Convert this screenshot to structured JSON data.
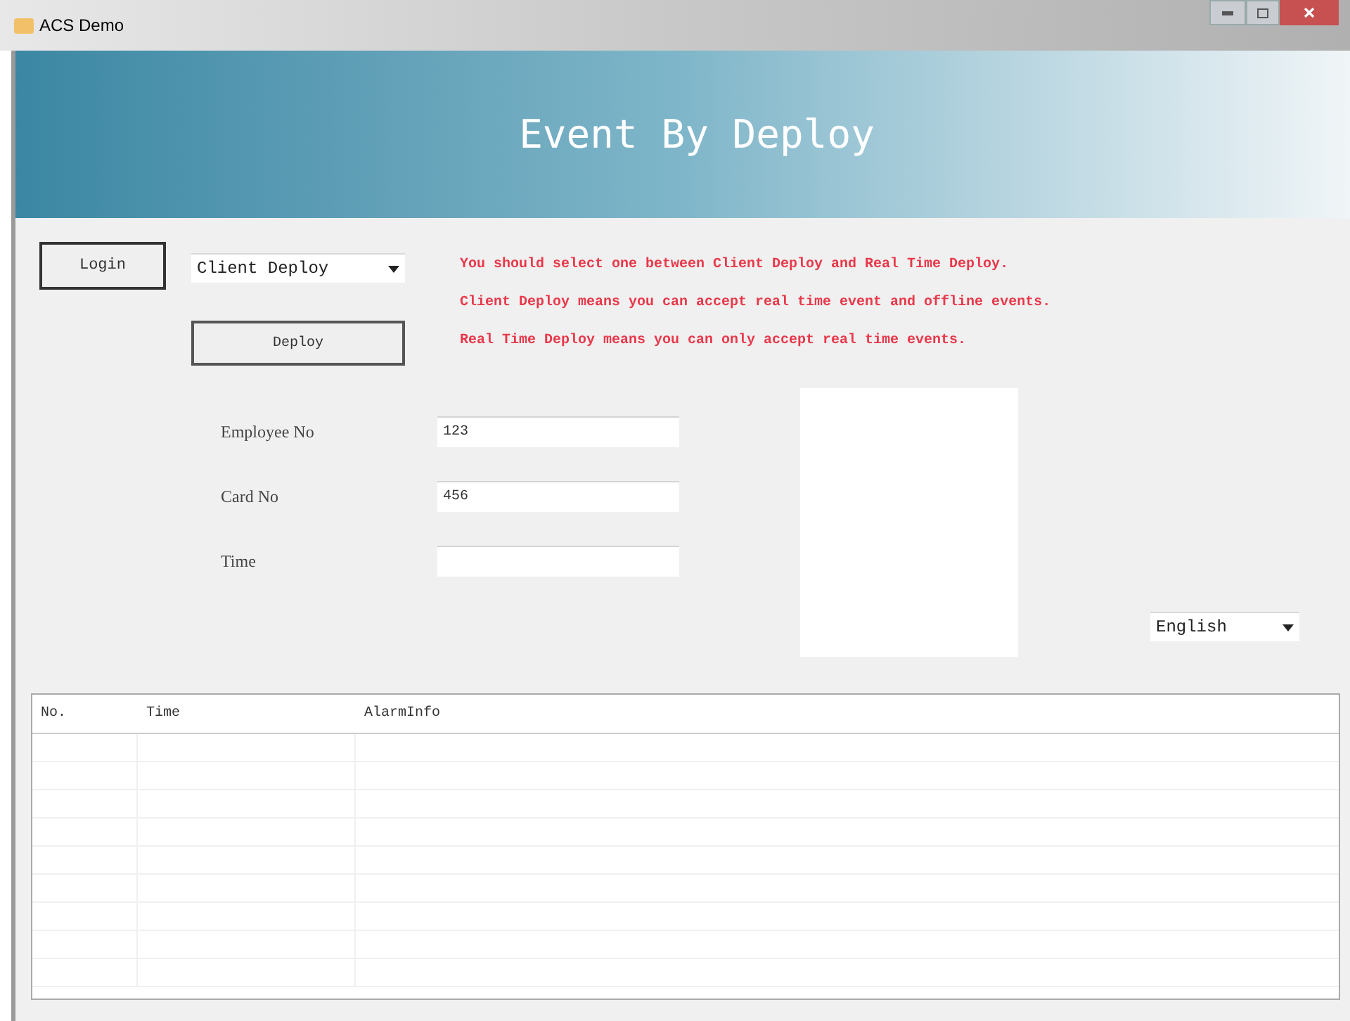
{
  "window": {
    "title": "ACS Demo"
  },
  "banner": {
    "title": "Event By Deploy"
  },
  "login_button": "Login",
  "deploy_mode": {
    "value": "Client Deploy"
  },
  "deploy_button": "Deploy",
  "notes": [
    "You should select one between Client Deploy and Real Time Deploy.",
    "Client Deploy means you can accept real time event and offline events.",
    "Real Time Deploy means you can only accept real time events."
  ],
  "fields": [
    {
      "label": "Employee No",
      "value": "123"
    },
    {
      "label": "Card No",
      "value": "456"
    },
    {
      "label": "Time"
    }
  ],
  "language": {
    "value": "English"
  },
  "table": {
    "columns": [
      "No.",
      "Time",
      "AlarmInfo"
    ]
  }
}
